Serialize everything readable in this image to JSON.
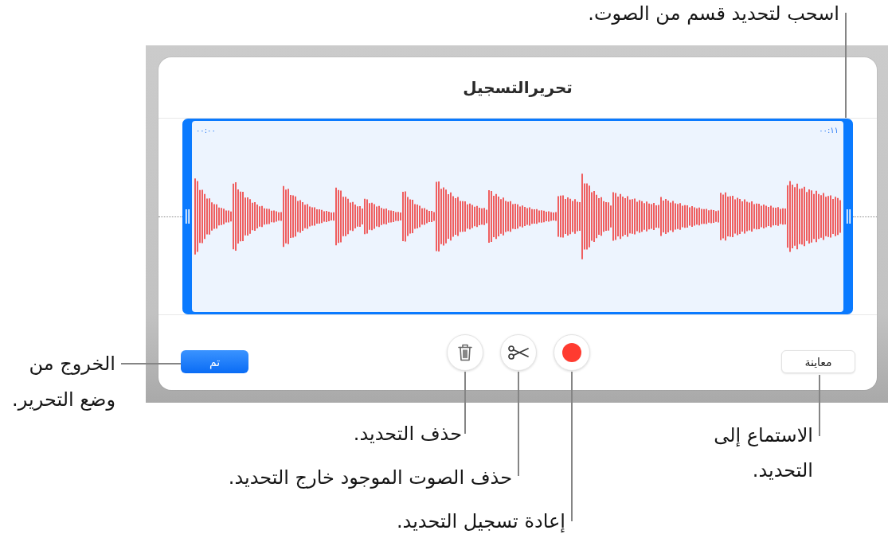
{
  "dialog": {
    "title": "تحريرالتسجيل",
    "selection": {
      "start_time": "٠٠:٠٠",
      "end_time": "٠٠:١١"
    },
    "buttons": [
      {
        "kind": "preview",
        "label": "معاينة"
      },
      {
        "kind": "record"
      },
      {
        "kind": "trim"
      },
      {
        "kind": "delete"
      },
      {
        "kind": "done",
        "label": "تم"
      }
    ]
  },
  "callouts": [
    {
      "text": "اسحب لتحديد قسم من الصوت."
    },
    {
      "text": "الخروج من\nوضع التحرير."
    },
    {
      "text": "حذف التحديد."
    },
    {
      "text": "حذف الصوت الموجود خارج التحديد."
    },
    {
      "text": "إعادة تسجيل التحديد."
    },
    {
      "text": "الاستماع إلى\nالتحديد."
    }
  ]
}
